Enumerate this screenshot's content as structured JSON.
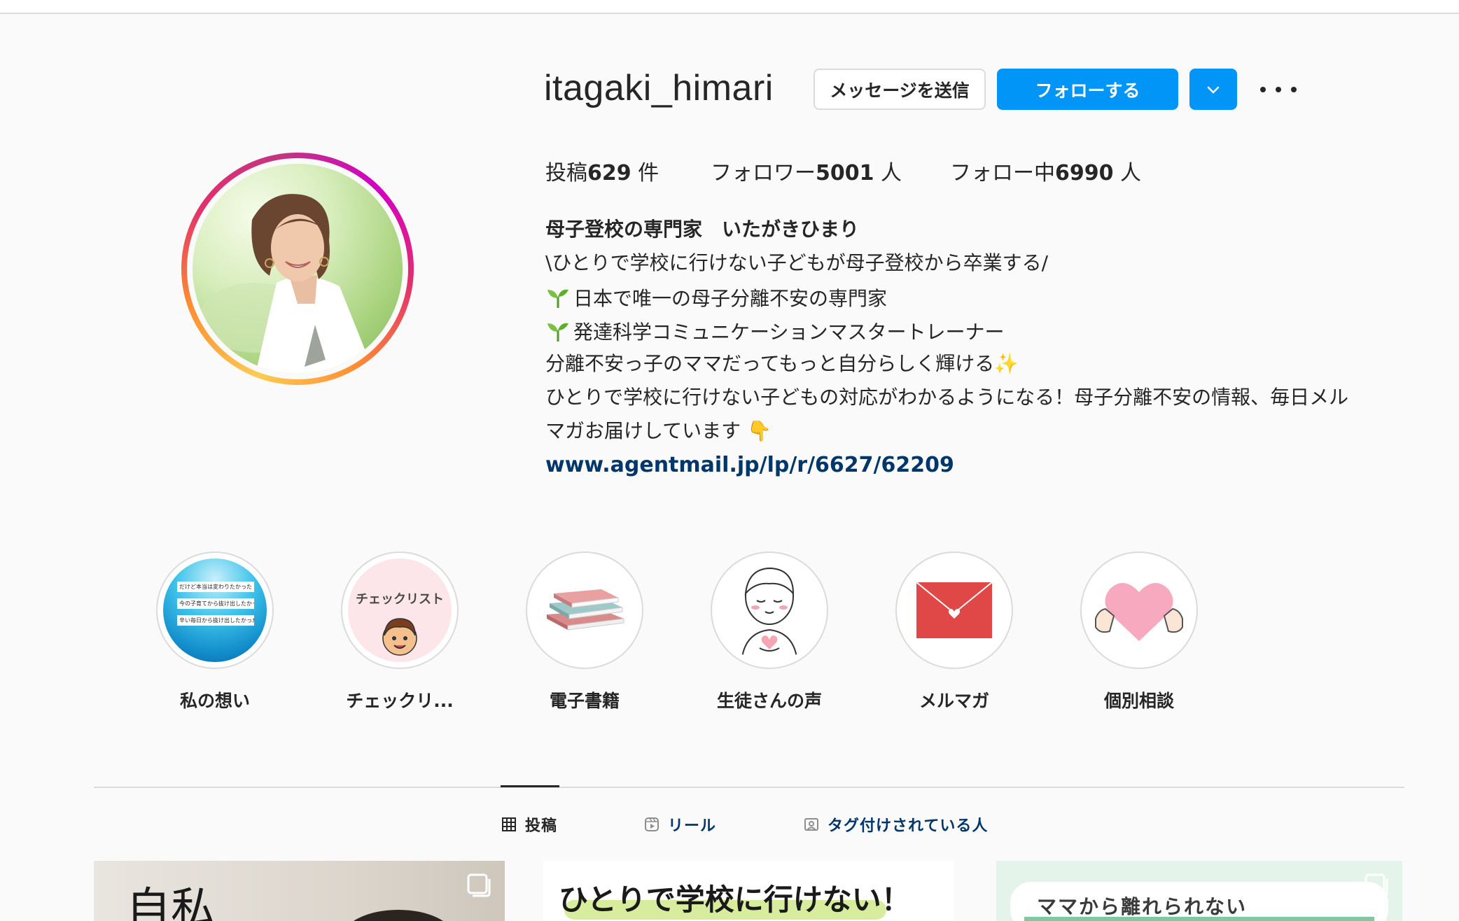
{
  "profile": {
    "username": "itagaki_himari",
    "message_button": "メッセージを送信",
    "follow_button": "フォローする"
  },
  "stats": [
    {
      "label": "投稿",
      "value": "629",
      "unit": " 件"
    },
    {
      "label": "フォロワー",
      "value": "5001",
      "unit": " 人"
    },
    {
      "label": "フォロー中",
      "value": "6990",
      "unit": " 人"
    }
  ],
  "bio": {
    "name": "母子登校の専門家　いたがきひまり",
    "line1": "\\ひとりで学校に行けない子どもが母子登校から卒業する/",
    "line2": "日本で唯一の母子分離不安の専門家",
    "line3": "発達科学コミュニケーションマスタートレーナー",
    "line4": "分離不安っ子のママだってもっと自分らしく輝ける✨",
    "line5": "ひとりで学校に行けない子どもの対応がわかるようになる！母子分離不安の情報、毎日メル",
    "line6": "マガお届けしています 👇",
    "link": "www.agentmail.jp/lp/r/6627/62209"
  },
  "highlights": [
    {
      "label": "私の想い",
      "cover_lines": [
        "だけど本当は変わりたかった",
        "今の子育てから抜け出したかった",
        "辛い毎日から抜け出したかった"
      ]
    },
    {
      "label": "チェックリ...",
      "cover_text": "チェックリスト"
    },
    {
      "label": "電子書籍"
    },
    {
      "label": "生徒さんの声"
    },
    {
      "label": "メルマガ"
    },
    {
      "label": "個別相談"
    }
  ],
  "tabs": [
    {
      "label": "投稿",
      "icon": "grid-icon",
      "active": true
    },
    {
      "label": "リール",
      "icon": "reels-icon",
      "active": false
    },
    {
      "label": "タグ付けされている人",
      "icon": "tagged-icon",
      "active": false
    }
  ],
  "posts": [
    {
      "text": "自私"
    },
    {
      "text": "ひとりで学校に行けない！"
    },
    {
      "text": "ママから離れられない"
    }
  ],
  "colors": {
    "accent": "#0095f6",
    "link": "#00376b",
    "text": "#262626",
    "border": "#dbdbdb"
  }
}
